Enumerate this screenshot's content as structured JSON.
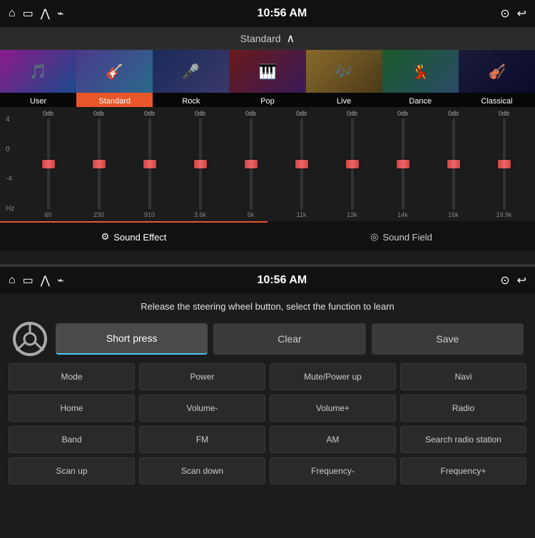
{
  "topPanel": {
    "statusBar": {
      "time": "10:56 AM",
      "icons": [
        "home",
        "screen",
        "up",
        "usb"
      ]
    },
    "presetLabel": "Standard",
    "presets": [
      {
        "name": "User",
        "active": false
      },
      {
        "name": "Standard",
        "active": true
      },
      {
        "name": "Rock",
        "active": false
      },
      {
        "name": "Pop",
        "active": false
      },
      {
        "name": "Live",
        "active": false
      },
      {
        "name": "Dance",
        "active": false
      },
      {
        "name": "Classical",
        "active": false
      }
    ],
    "eqBands": [
      {
        "db": "0db",
        "freq": "60"
      },
      {
        "db": "0db",
        "freq": "230"
      },
      {
        "db": "0db",
        "freq": "910"
      },
      {
        "db": "0db",
        "freq": "3.6k"
      },
      {
        "db": "0db",
        "freq": "5k"
      },
      {
        "db": "0db",
        "freq": "11k"
      },
      {
        "db": "0db",
        "freq": "13k"
      },
      {
        "db": "0db",
        "freq": "14k"
      },
      {
        "db": "0db",
        "freq": "16k"
      },
      {
        "db": "0db",
        "freq": "19.9k"
      }
    ],
    "yLabels": [
      "4",
      "0",
      "-4",
      "Hz"
    ],
    "tabs": [
      {
        "label": "Sound Effect",
        "active": true
      },
      {
        "label": "Sound Field",
        "active": false
      }
    ]
  },
  "bottomPanel": {
    "statusBar": {
      "time": "10:56 AM"
    },
    "instruction": "Release the steering wheel button, select the function to learn",
    "buttons": {
      "shortPress": "Short press",
      "clear": "Clear",
      "save": "Save"
    },
    "funcButtons": [
      "Mode",
      "Power",
      "Mute/Power up",
      "Navi",
      "Home",
      "Volume-",
      "Volume+",
      "Radio",
      "Band",
      "FM",
      "AM",
      "Search radio station",
      "Scan up",
      "Scan down",
      "Frequency-",
      "Frequency+"
    ]
  }
}
